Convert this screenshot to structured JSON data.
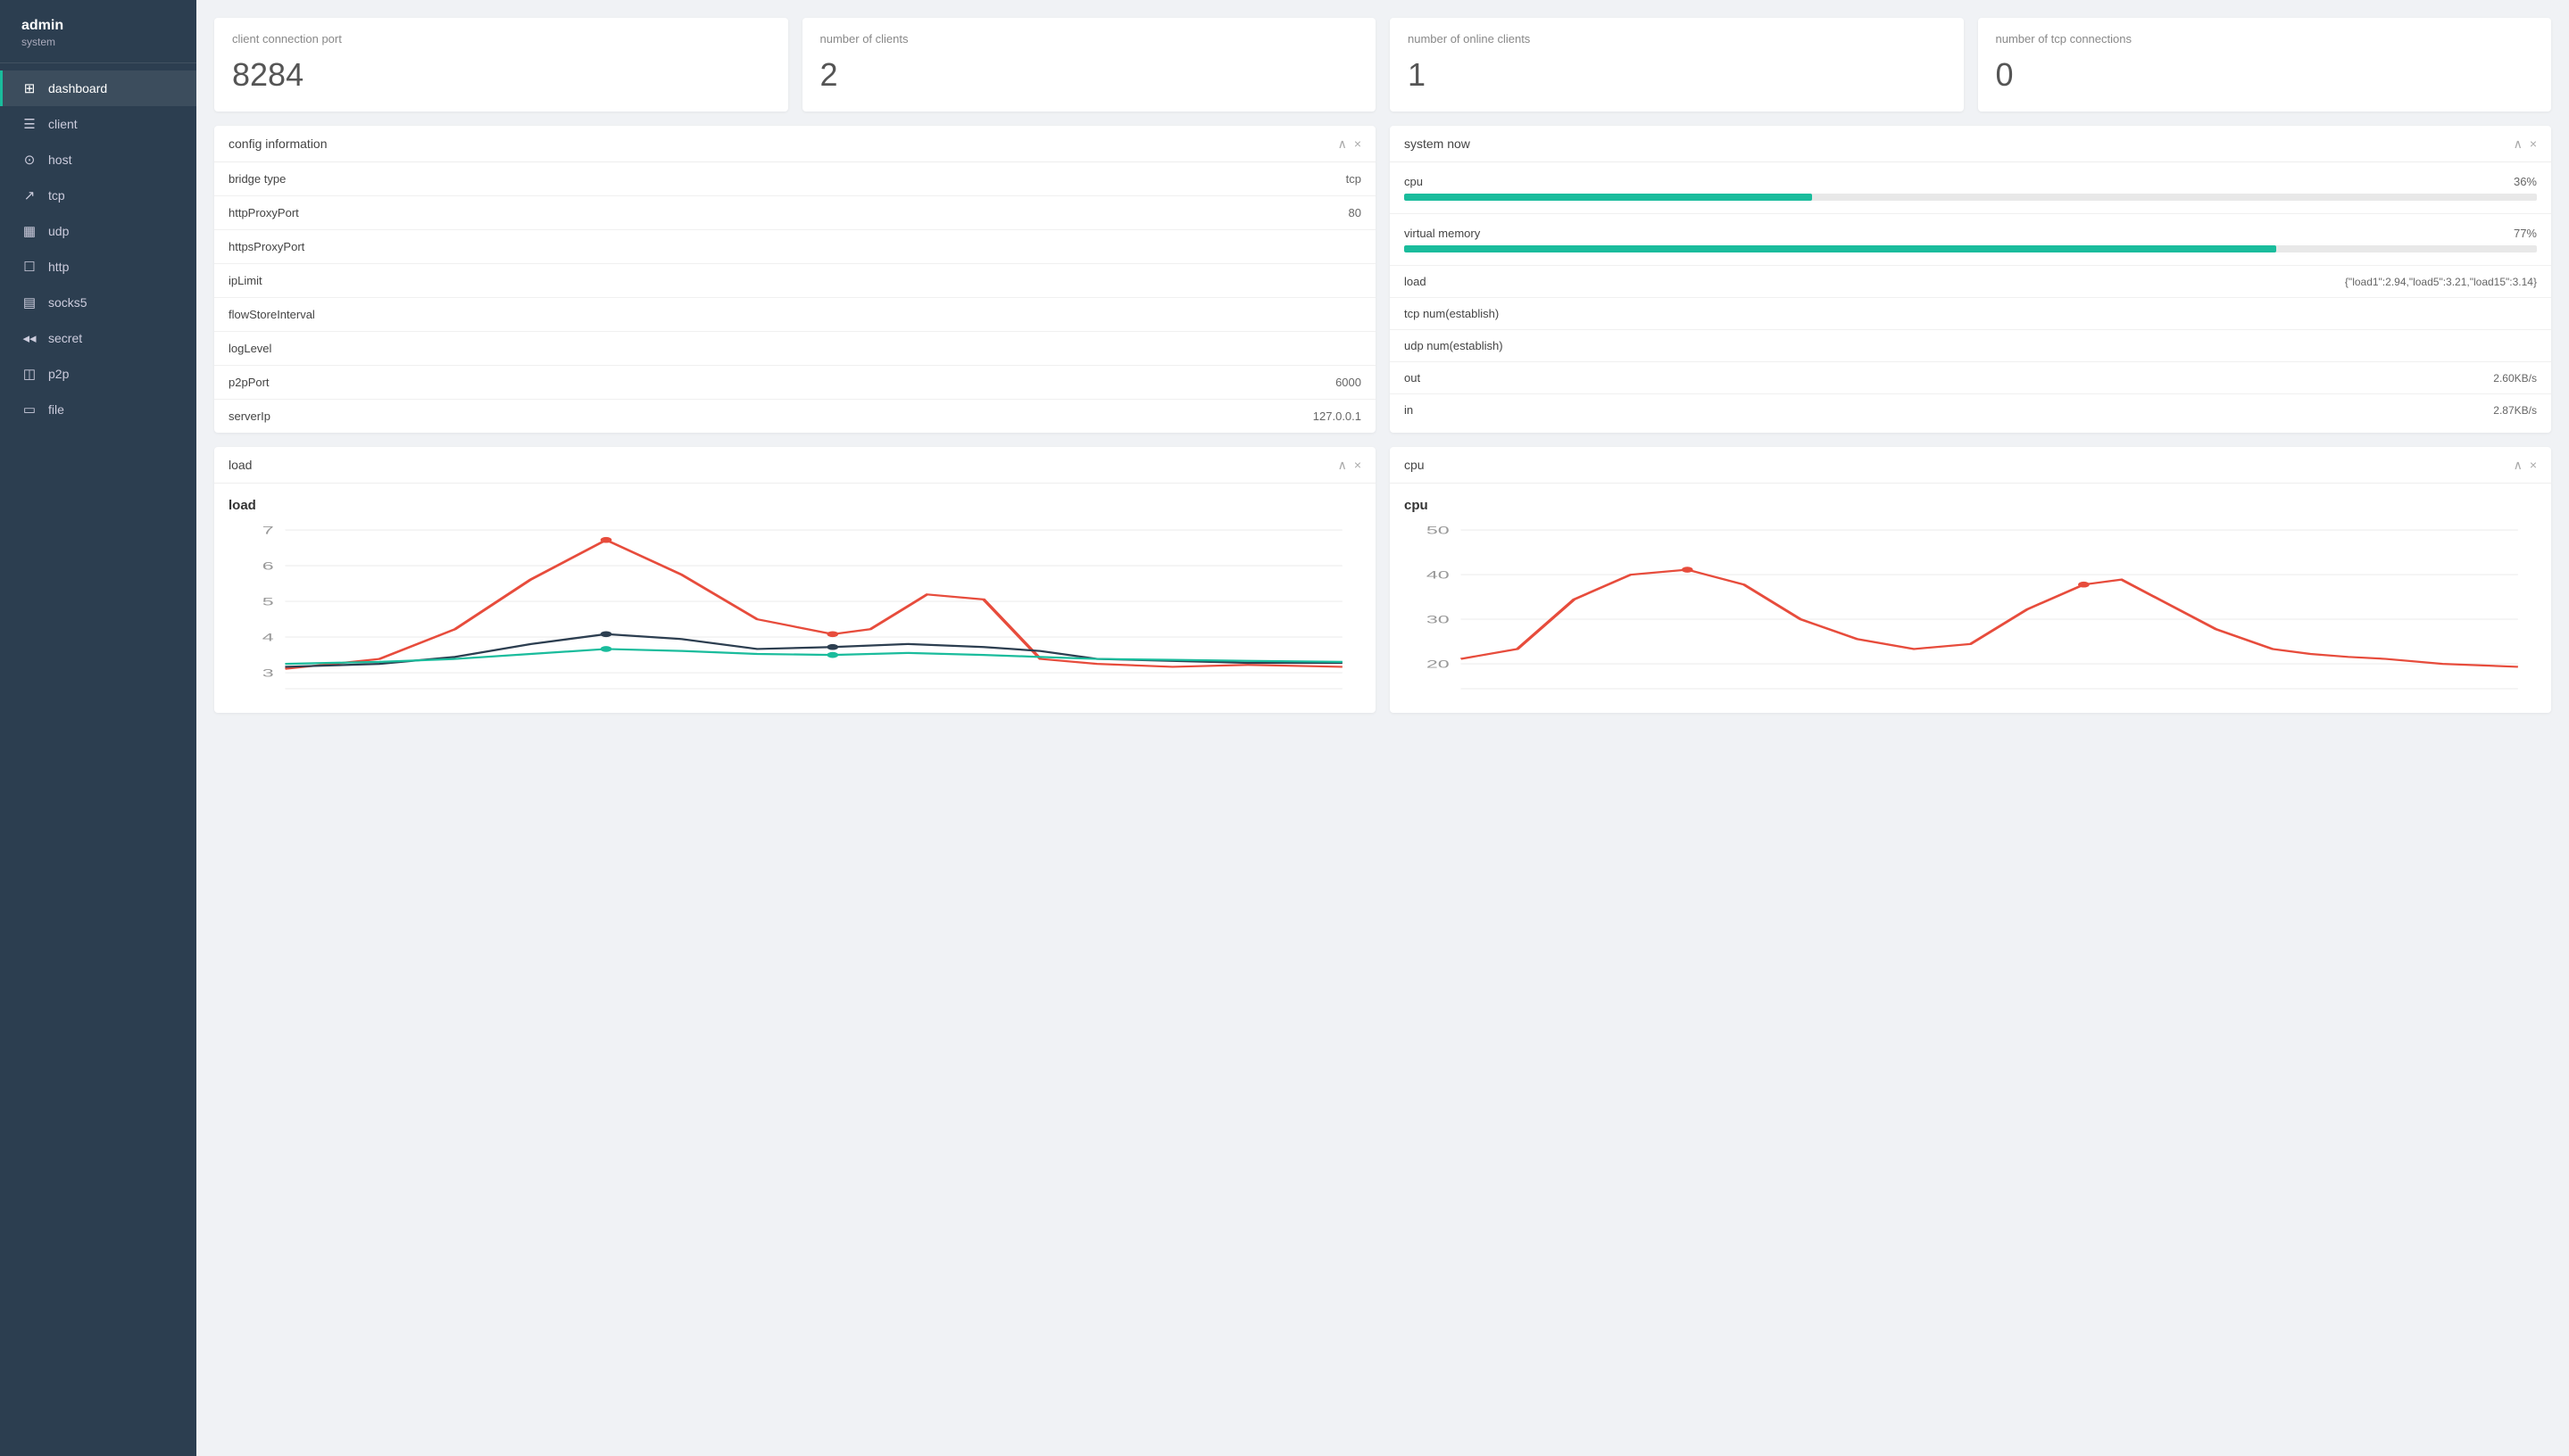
{
  "sidebar": {
    "user": {
      "name": "admin",
      "role": "system"
    },
    "items": [
      {
        "id": "dashboard",
        "label": "dashboard",
        "icon": "⊞",
        "active": true
      },
      {
        "id": "client",
        "label": "client",
        "icon": "☰",
        "active": false
      },
      {
        "id": "host",
        "label": "host",
        "icon": "⊙",
        "active": false
      },
      {
        "id": "tcp",
        "label": "tcp",
        "icon": "↗",
        "active": false
      },
      {
        "id": "udp",
        "label": "udp",
        "icon": "▦",
        "active": false
      },
      {
        "id": "http",
        "label": "http",
        "icon": "☐",
        "active": false
      },
      {
        "id": "socks5",
        "label": "socks5",
        "icon": "▤",
        "active": false
      },
      {
        "id": "secret",
        "label": "secret",
        "icon": "◂◂",
        "active": false
      },
      {
        "id": "p2p",
        "label": "p2p",
        "icon": "◫",
        "active": false
      },
      {
        "id": "file",
        "label": "file",
        "icon": "▭",
        "active": false
      }
    ]
  },
  "stat_cards": [
    {
      "id": "client-connection-port",
      "label": "client connection port",
      "value": "8284"
    },
    {
      "id": "number-of-clients",
      "label": "number of clients",
      "value": "2"
    },
    {
      "id": "number-of-online-clients",
      "label": "number of online clients",
      "value": "1"
    },
    {
      "id": "number-of-tcp-connections",
      "label": "number of tcp connections",
      "value": "0"
    }
  ],
  "config_panel": {
    "title": "config information",
    "rows": [
      {
        "key": "bridge type",
        "value": "tcp"
      },
      {
        "key": "httpProxyPort",
        "value": "80"
      },
      {
        "key": "httpsProxyPort",
        "value": ""
      },
      {
        "key": "ipLimit",
        "value": ""
      },
      {
        "key": "flowStoreInterval",
        "value": ""
      },
      {
        "key": "logLevel",
        "value": ""
      },
      {
        "key": "p2pPort",
        "value": "6000"
      },
      {
        "key": "serverIp",
        "value": "127.0.0.1"
      }
    ]
  },
  "system_panel": {
    "title": "system now",
    "cpu": {
      "label": "cpu",
      "value": 36,
      "display": "36%"
    },
    "virtual_memory": {
      "label": "virtual memory",
      "value": 77,
      "display": "77%"
    },
    "rows": [
      {
        "key": "load",
        "value": "{\"load1\":2.94,\"load5\":3.21,\"load15\":3.14}"
      },
      {
        "key": "tcp num(establish)",
        "value": ""
      },
      {
        "key": "udp num(establish)",
        "value": ""
      },
      {
        "key": "out",
        "value": "2.60KB/s"
      },
      {
        "key": "in",
        "value": "2.87KB/s"
      }
    ]
  },
  "load_chart": {
    "title": "load",
    "chart_title": "load",
    "y_labels": [
      "7",
      "6",
      "5",
      "4",
      "3"
    ],
    "y_min": 3,
    "y_max": 7
  },
  "cpu_chart": {
    "title": "cpu",
    "chart_title": "cpu",
    "y_labels": [
      "50",
      "40",
      "30",
      "20"
    ],
    "y_min": 20,
    "y_max": 50
  },
  "buttons": {
    "collapse": "∧",
    "close": "×"
  }
}
